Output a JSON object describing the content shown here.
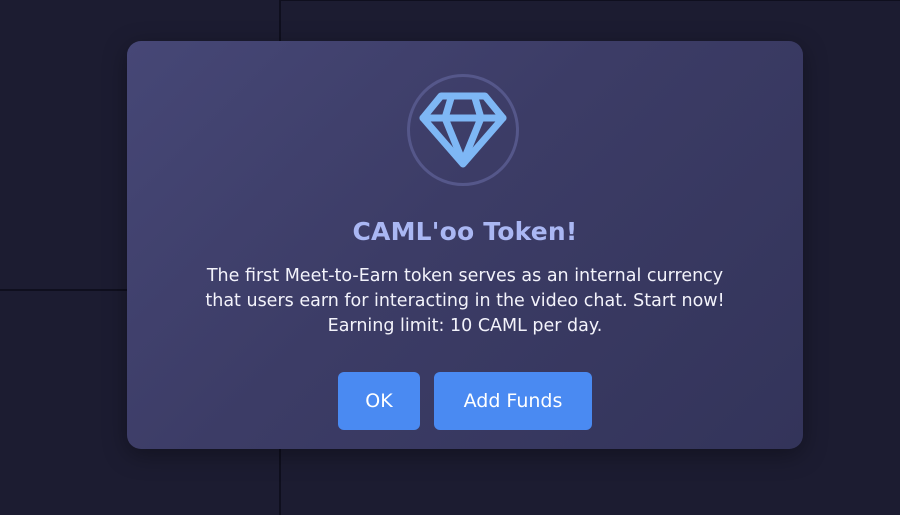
{
  "dialog": {
    "icon": "diamond-icon",
    "title": "CAML'oo Token!",
    "body_lines": [
      "The first Meet-to-Earn token serves as an internal currency",
      "that users earn for interacting in the video chat. Start now!",
      "Earning limit: 10 CAML per day."
    ],
    "buttons": {
      "ok_label": "OK",
      "add_funds_label": "Add Funds"
    }
  },
  "colors": {
    "background": "#1c1c31",
    "dialog": "#3c3c66",
    "title": "#aab7f3",
    "icon": "#7eb7f5",
    "button": "#4a8af2"
  }
}
